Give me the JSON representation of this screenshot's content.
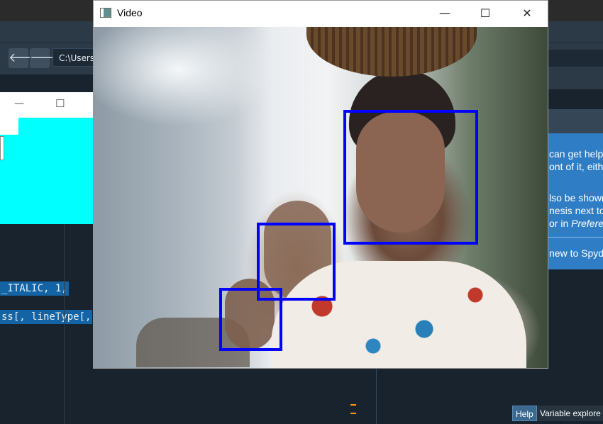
{
  "ide": {
    "path": "C:\\Users",
    "nav_back": "🡐",
    "nav_forward": "🡒",
    "code_lines": [
      "_ITALIC, 1,",
      "ss[, lineType[,"
    ],
    "help_lines": [
      "can get help o",
      "ont of it, eithe",
      "lso be shown",
      "nesis next to",
      "or in ",
      "Prefere",
      "new to Spyde"
    ],
    "tabs": {
      "help": "Help",
      "variable_explorer": "Variable explore"
    }
  },
  "bg_window": {
    "minimize_glyph": "—",
    "maximize_glyph": "☐"
  },
  "video_window": {
    "title": "Video",
    "minimize_glyph": "—",
    "maximize_glyph": "☐",
    "close_glyph": "✕",
    "detections": 3,
    "box_color": "#0000ff"
  },
  "colors": {
    "ide_background": "#19232d",
    "help_panel": "#2e7dc5",
    "bg_window_cyan": "#00ffff",
    "code_highlight": "#1464a5"
  }
}
